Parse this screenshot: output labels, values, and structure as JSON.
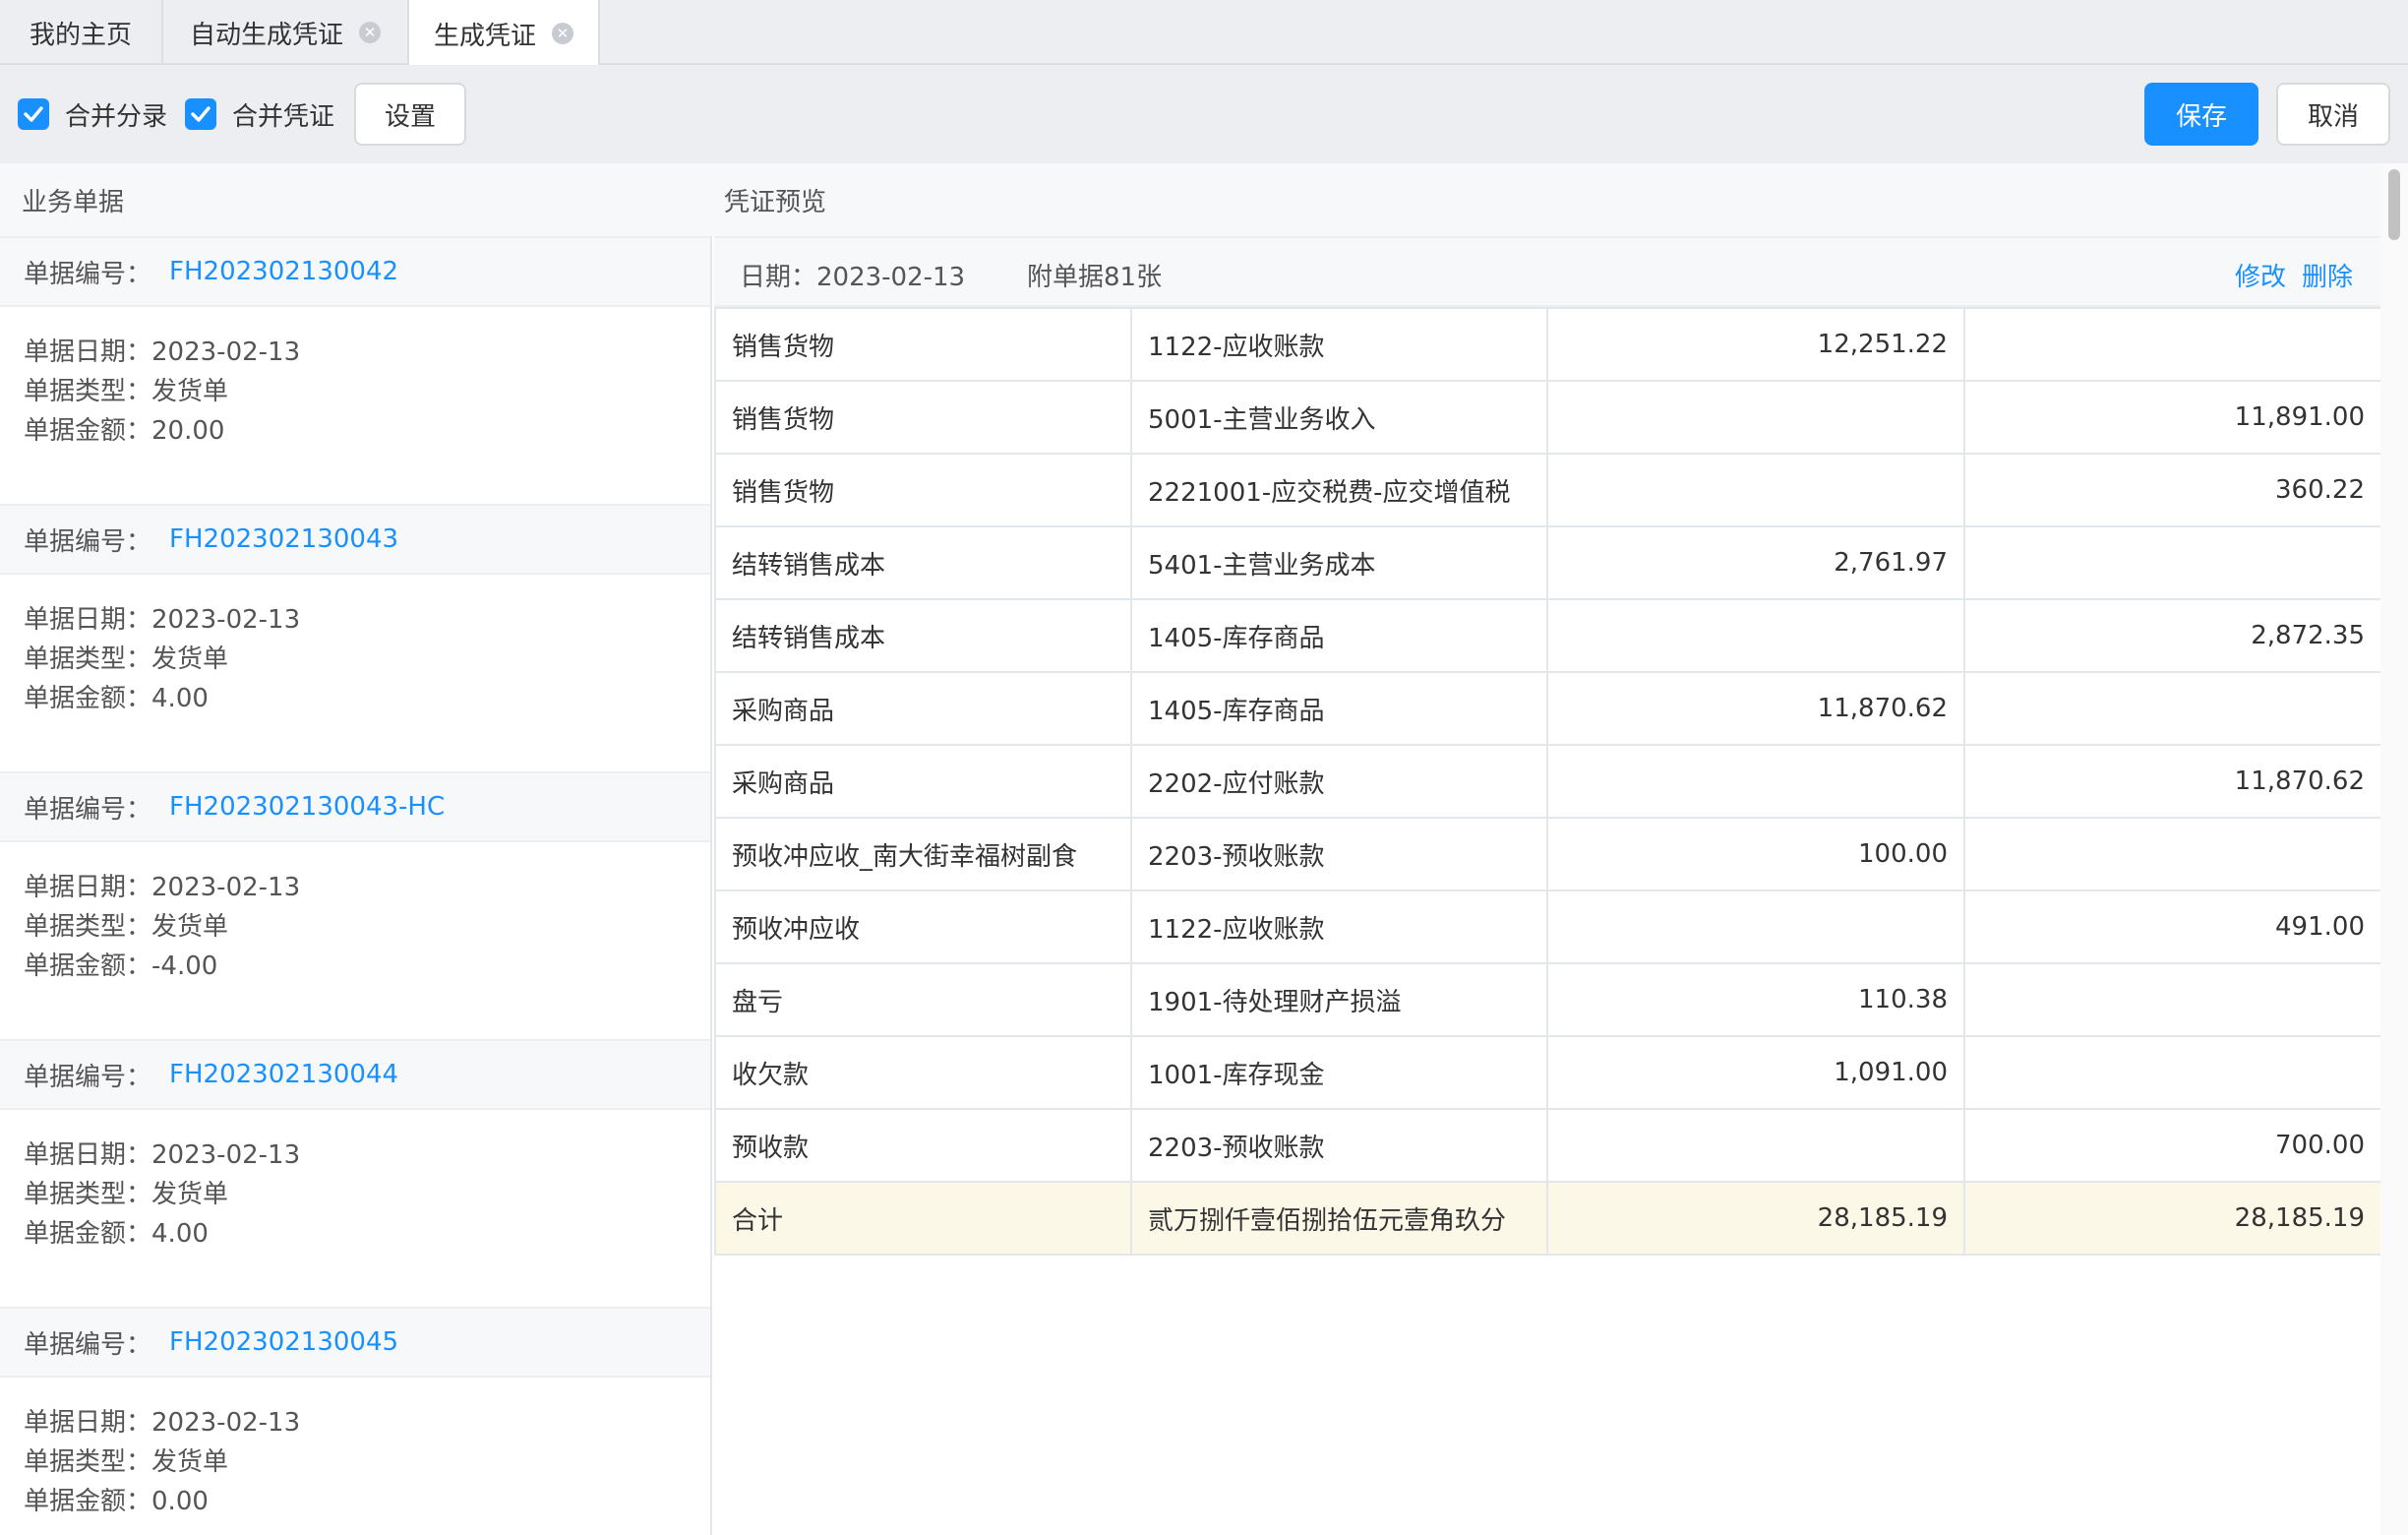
{
  "tabs": [
    {
      "label": "我的主页"
    },
    {
      "label": "自动生成凭证"
    },
    {
      "label": "生成凭证"
    }
  ],
  "toolbar": {
    "merge_entries_label": "合并分录",
    "merge_entries_checked": true,
    "merge_vouchers_label": "合并凭证",
    "merge_vouchers_checked": true,
    "settings_label": "设置",
    "save_label": "保存",
    "cancel_label": "取消",
    "primary_color": "#1890ff"
  },
  "left_panel": {
    "title": "业务单据",
    "no_label": "单据编号：",
    "date_label": "单据日期：",
    "type_label": "单据类型：",
    "amount_label": "单据金额：",
    "documents": [
      {
        "no": "FH202302130042",
        "date": "2023-02-13",
        "type": "发货单",
        "amount": "20.00"
      },
      {
        "no": "FH202302130043",
        "date": "2023-02-13",
        "type": "发货单",
        "amount": "4.00"
      },
      {
        "no": "FH202302130043-HC",
        "date": "2023-02-13",
        "type": "发货单",
        "amount": "-4.00"
      },
      {
        "no": "FH202302130044",
        "date": "2023-02-13",
        "type": "发货单",
        "amount": "4.00"
      },
      {
        "no": "FH202302130045",
        "date": "2023-02-13",
        "type": "发货单",
        "amount": "0.00"
      }
    ]
  },
  "right_panel": {
    "title": "凭证预览",
    "date_text": "日期：2023-02-13",
    "attachments_text": "附单据81张",
    "edit_label": "修改",
    "delete_label": "删除",
    "entries": [
      {
        "summary": "销售货物",
        "account": "1122-应收账款",
        "debit": "12,251.22",
        "credit": ""
      },
      {
        "summary": "销售货物",
        "account": "5001-主营业务收入",
        "debit": "",
        "credit": "11,891.00"
      },
      {
        "summary": "销售货物",
        "account": "2221001-应交税费-应交增值税",
        "debit": "",
        "credit": "360.22"
      },
      {
        "summary": "结转销售成本",
        "account": "5401-主营业务成本",
        "debit": "2,761.97",
        "credit": ""
      },
      {
        "summary": "结转销售成本",
        "account": "1405-库存商品",
        "debit": "",
        "credit": "2,872.35"
      },
      {
        "summary": "采购商品",
        "account": "1405-库存商品",
        "debit": "11,870.62",
        "credit": ""
      },
      {
        "summary": "采购商品",
        "account": "2202-应付账款",
        "debit": "",
        "credit": "11,870.62"
      },
      {
        "summary": "预收冲应收_南大街幸福树副食",
        "account": "2203-预收账款",
        "debit": "100.00",
        "credit": ""
      },
      {
        "summary": "预收冲应收",
        "account": "1122-应收账款",
        "debit": "",
        "credit": "491.00"
      },
      {
        "summary": "盘亏",
        "account": "1901-待处理财产损溢",
        "debit": "110.38",
        "credit": ""
      },
      {
        "summary": "收欠款",
        "account": "1001-库存现金",
        "debit": "1,091.00",
        "credit": ""
      },
      {
        "summary": "预收款",
        "account": "2203-预收账款",
        "debit": "",
        "credit": "700.00"
      }
    ],
    "total": {
      "label": "合计",
      "amount_in_words": "贰万捌仟壹佰捌拾伍元壹角玖分",
      "debit": "28,185.19",
      "credit": "28,185.19"
    }
  }
}
